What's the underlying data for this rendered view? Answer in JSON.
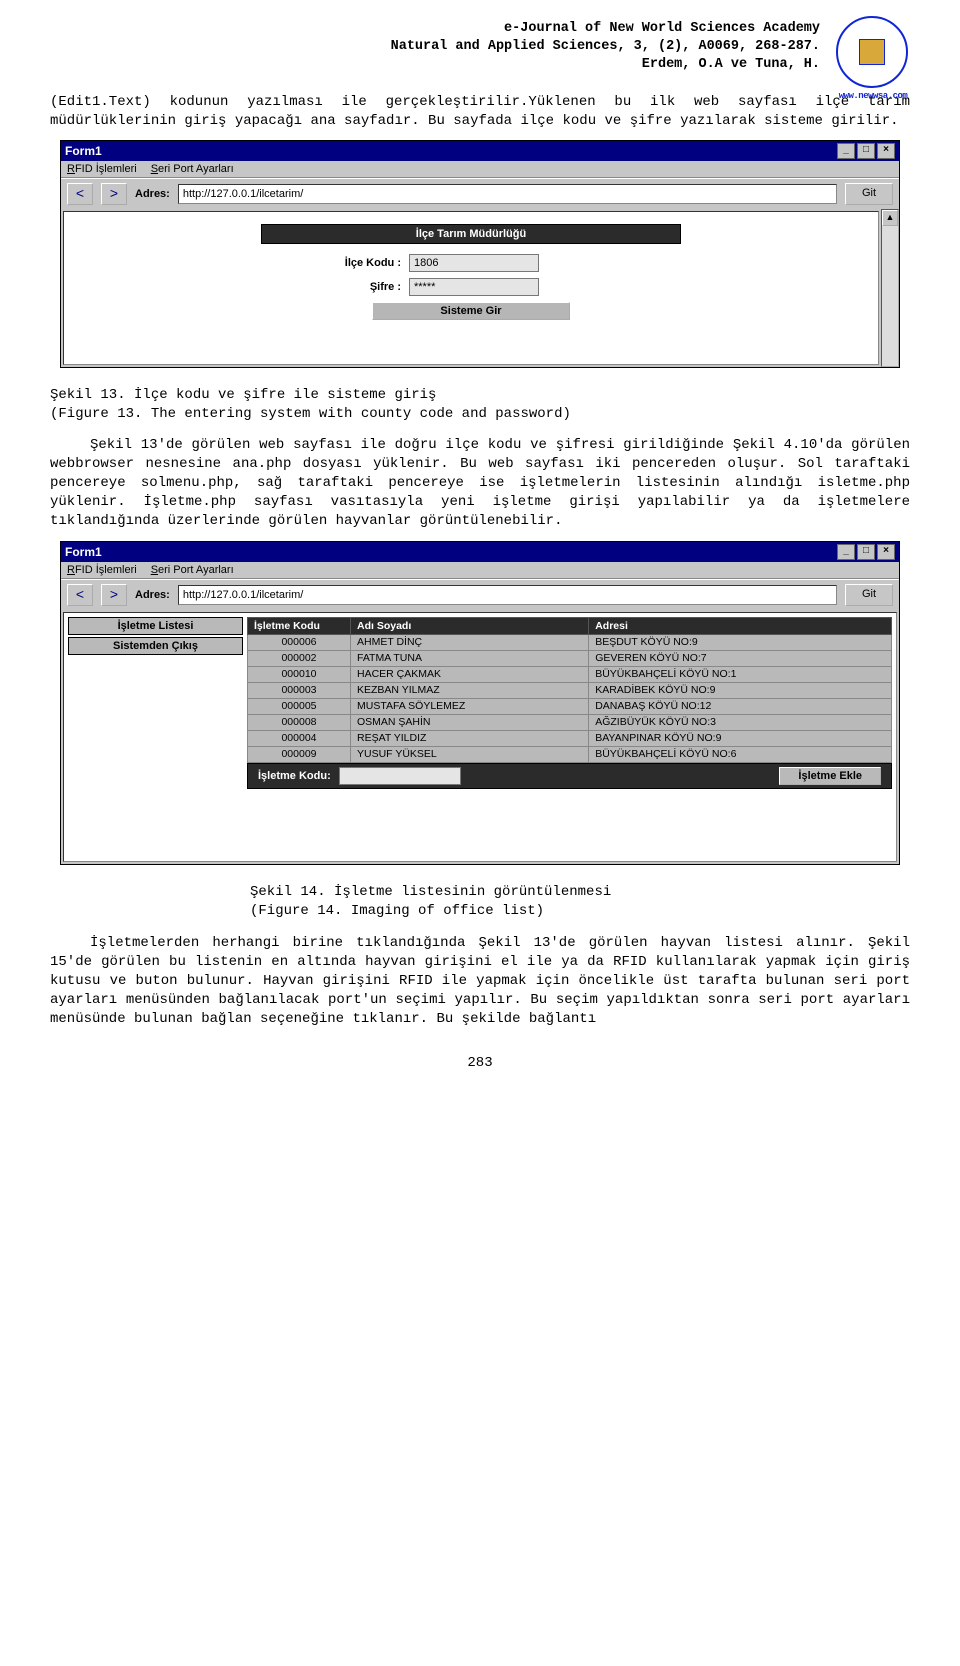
{
  "header": {
    "line1": "e-Journal of New World Sciences Academy",
    "line2": "Natural and Applied Sciences, 3, (2), A0069, 268-287.",
    "line3": "Erdem, O.A ve Tuna, H.",
    "logo_url": "www.newwsa.com"
  },
  "para1": "(Edit1.Text) kodunun yazılması ile gerçekleştirilir.Yüklenen bu ilk web sayfası ilçe tarım müdürlüklerinin giriş yapacağı ana sayfadır. Bu sayfada ilçe kodu ve şifre yazılarak sisteme girilir.",
  "shot1": {
    "title": "Form1",
    "menu1": "RFID İşlemleri",
    "menu2": "Seri Port Ayarları",
    "nav_back": "<",
    "nav_fwd": ">",
    "addr_label": "Adres:",
    "addr_value": "http://127.0.0.1/ilcetarim/",
    "go": "Git",
    "panel_title": "İlçe Tarım Müdürlüğü",
    "field1_label": "İlçe Kodu :",
    "field1_value": "1806",
    "field2_label": "Şifre :",
    "field2_value": "*****",
    "submit": "Sisteme Gir",
    "min": "_",
    "max": "□",
    "close": "×"
  },
  "caption1_l1": "Şekil 13. İlçe kodu ve şifre ile sisteme giriş",
  "caption1_l2": "(Figure 13. The entering system with county code and password)",
  "para2": "Şekil 13'de görülen web sayfası ile doğru ilçe kodu ve şifresi girildiğinde Şekil 4.10'da görülen webbrowser nesnesine ana.php dosyası yüklenir. Bu web sayfası iki pencereden oluşur. Sol taraftaki pencereye solmenu.php, sağ taraftaki pencereye ise işletmelerin listesinin alındığı isletme.php yüklenir. İşletme.php sayfası vasıtasıyla yeni işletme girişi yapılabilir ya da işletmelere tıklandığında üzerlerinde görülen hayvanlar görüntülenebilir.",
  "shot2": {
    "title": "Form1",
    "menu1": "RFID İşlemleri",
    "menu2": "Seri Port Ayarları",
    "nav_back": "<",
    "nav_fwd": ">",
    "addr_label": "Adres:",
    "addr_value": "http://127.0.0.1/ilcetarim/",
    "go": "Git",
    "left_item1": "İşletme Listesi",
    "left_item2": "Sistemden Çıkış",
    "th1": "İşletme Kodu",
    "th2": "Adı Soyadı",
    "th3": "Adresi",
    "rows": [
      {
        "c1": "000006",
        "c2": "AHMET DİNÇ",
        "c3": "BEŞDUT KÖYÜ NO:9"
      },
      {
        "c1": "000002",
        "c2": "FATMA TUNA",
        "c3": "GEVEREN KÖYÜ NO:7"
      },
      {
        "c1": "000010",
        "c2": "HACER ÇAKMAK",
        "c3": "BÜYÜKBAHÇELİ KÖYÜ NO:1"
      },
      {
        "c1": "000003",
        "c2": "KEZBAN YILMAZ",
        "c3": "KARADİBEK KÖYÜ NO:9"
      },
      {
        "c1": "000005",
        "c2": "MUSTAFA SÖYLEMEZ",
        "c3": "DANABAŞ KÖYÜ NO:12"
      },
      {
        "c1": "000008",
        "c2": "OSMAN ŞAHİN",
        "c3": "AĞZIBÜYÜK KÖYÜ NO:3"
      },
      {
        "c1": "000004",
        "c2": "REŞAT YILDIZ",
        "c3": "BAYANPINAR KÖYÜ NO:9"
      },
      {
        "c1": "000009",
        "c2": "YUSUF YÜKSEL",
        "c3": "BÜYÜKBAHÇELİ KÖYÜ NO:6"
      }
    ],
    "footer_label": "İşletme Kodu:",
    "footer_btn": "İşletme Ekle"
  },
  "caption2_l1": "Şekil 14. İşletme listesinin görüntülenmesi",
  "caption2_l2": "(Figure 14. Imaging of  office list)",
  "para3": "İşletmelerden herhangi birine tıklandığında Şekil 13'de görülen hayvan listesi alınır. Şekil 15'de görülen bu listenin en altında hayvan girişini el ile ya da RFID kullanılarak yapmak için giriş kutusu ve buton bulunur. Hayvan girişini RFID ile yapmak için öncelikle üst tarafta bulunan seri port ayarları menüsünden bağlanılacak port'un seçimi yapılır. Bu seçim yapıldıktan sonra seri port ayarları menüsünde bulunan bağlan seçeneğine tıklanır. Bu şekilde bağlantı",
  "pagenum": "283"
}
